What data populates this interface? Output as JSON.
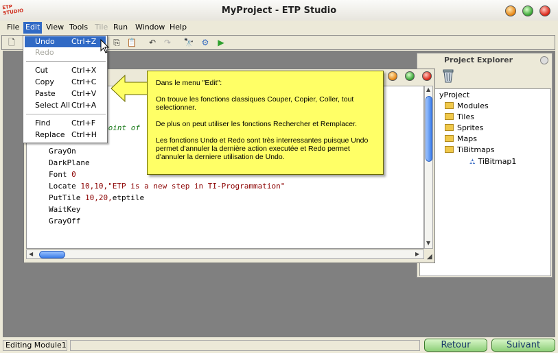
{
  "app": {
    "logo_text": "ETP STUDIO",
    "title": "MyProject - ETP Studio"
  },
  "menubar": {
    "file": "File",
    "edit": "Edit",
    "view": "View",
    "tools": "Tools",
    "tile": "Tile",
    "run": "Run",
    "window": "Window",
    "help": "Help"
  },
  "edit_menu": {
    "undo": {
      "label": "Undo",
      "shortcut": "Ctrl+Z"
    },
    "redo": {
      "label": "Redo"
    },
    "cut": {
      "label": "Cut",
      "shortcut": "Ctrl+X"
    },
    "copy": {
      "label": "Copy",
      "shortcut": "Ctrl+C"
    },
    "paste": {
      "label": "Paste",
      "shortcut": "Ctrl+V"
    },
    "select_all": {
      "label": "Select All",
      "shortcut": "Ctrl+A"
    },
    "find": {
      "label": "Find",
      "shortcut": "Ctrl+F"
    },
    "replace": {
      "label": "Replace",
      "shortcut": "Ctrl+H"
    }
  },
  "editor": {
    "comment_fragment": "point of",
    "lines": {
      "grayon": "GrayOn",
      "darkplane": "DarkPlane",
      "font_kw": "Font ",
      "font_arg": "0",
      "locate_kw": "Locate ",
      "locate_nums": "10,10,",
      "locate_str": "\"ETP is a new step in TI-Programmation\"",
      "puttile_kw": "PutTile ",
      "puttile_nums": "10,20,",
      "puttile_arg": "etptile",
      "waitkey": "WaitKey",
      "grayoff": "GrayOff"
    }
  },
  "callout": {
    "p1": "Dans le menu \"Edit\":",
    "p2": "On trouve les fonctions classiques Couper, Copier, Coller, tout selectionner.",
    "p3": "De plus on peut utiliser les fonctions Rechercher et Remplacer.",
    "p4": "Les fonctions Undo et Redo sont très interressantes puisque Undo permet d'annuler la dernière action executée et Redo permet d'annuler la derniere utilisation de Undo."
  },
  "project_explorer": {
    "title": "Project Explorer",
    "root": "yProject",
    "items": [
      "Modules",
      "Tiles",
      "Sprites",
      "Maps",
      "TiBitmaps"
    ],
    "bitmap": "TiBitmap1"
  },
  "status": {
    "text": "Editing Module1"
  },
  "nav": {
    "back": "Retour",
    "next": "Suivant"
  },
  "colors": {
    "menu_highlight": "#316ac5",
    "callout_bg": "#ffff66",
    "code_comment": "#1a7a1a",
    "code_literal": "#8b0000"
  }
}
